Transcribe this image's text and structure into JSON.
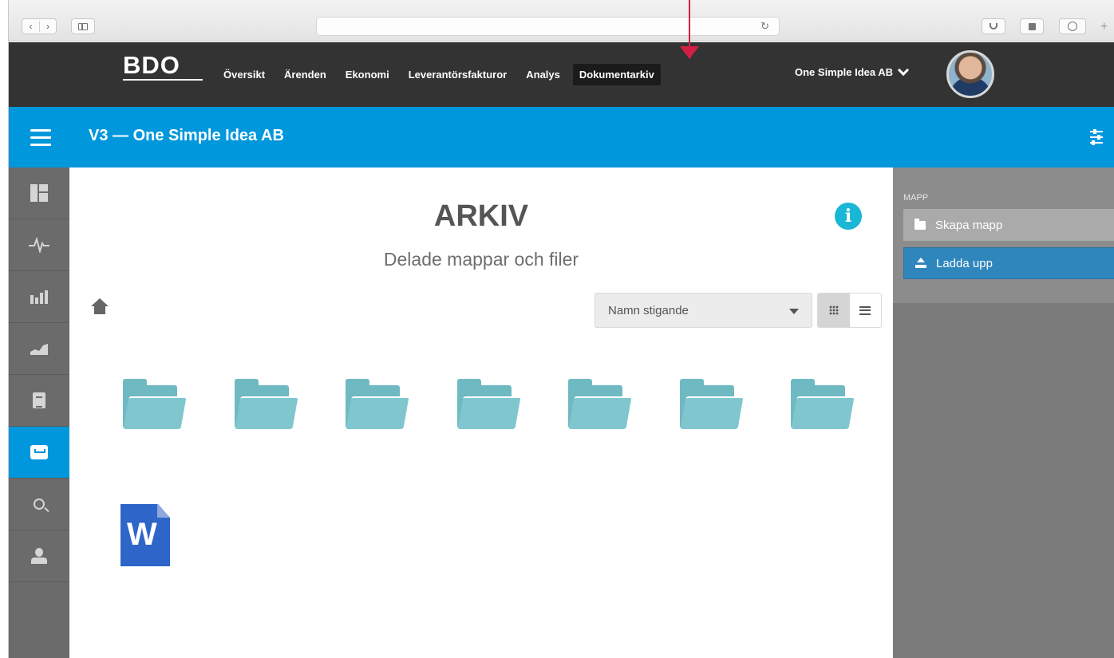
{
  "topbar": {
    "logo": "BDO",
    "nav": [
      "Översikt",
      "Ärenden",
      "Ekonomi",
      "Leverantörsfakturor",
      "Analys",
      "Dokumentarkiv"
    ],
    "active_nav": "Dokumentarkiv",
    "company": "One Simple Idea AB"
  },
  "header": {
    "title": "V3 — One Simple Idea AB"
  },
  "sidebar": {
    "items": [
      {
        "icon": "dashboard-icon"
      },
      {
        "icon": "pulse-icon"
      },
      {
        "icon": "bar-chart-icon"
      },
      {
        "icon": "area-chart-icon"
      },
      {
        "icon": "document-icon"
      },
      {
        "icon": "archive-icon",
        "active": true
      },
      {
        "icon": "search-icon"
      },
      {
        "icon": "user-icon"
      }
    ]
  },
  "main": {
    "title": "ARKIV",
    "subtitle": "Delade mappar och filer",
    "sort": {
      "selected": "Namn stigande"
    },
    "view": "grid",
    "folders": 7,
    "files": [
      {
        "type": "word",
        "letter": "W"
      }
    ]
  },
  "panel": {
    "label": "MAPP",
    "create_folder": "Skapa mapp",
    "upload": "Ladda upp"
  },
  "colors": {
    "topbar": "#333333",
    "header": "#0097dc",
    "folder": "#6fb9c2",
    "upload_button": "#2f86bd",
    "annotation_arrow": "#d41f44"
  }
}
